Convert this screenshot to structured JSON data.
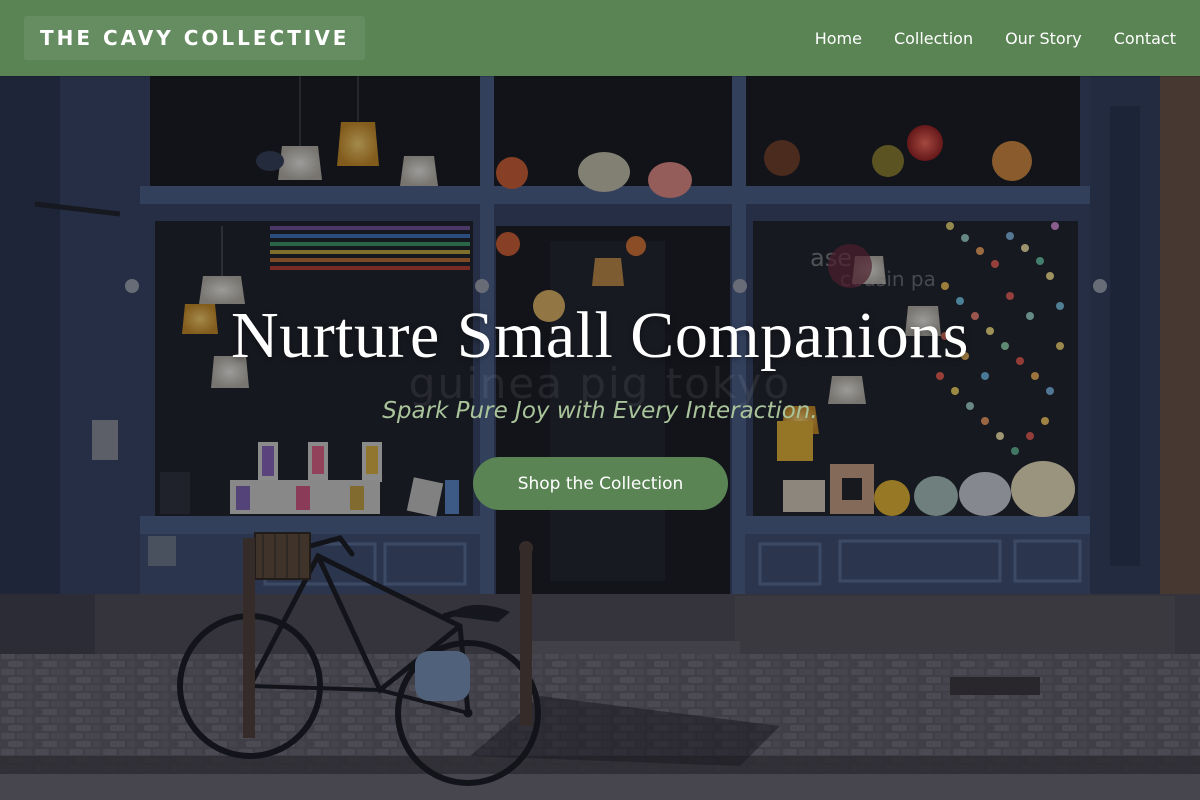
{
  "header": {
    "logo_text": "THE CAVY COLLECTIVE",
    "nav": [
      {
        "label": "Home"
      },
      {
        "label": "Collection"
      },
      {
        "label": "Our Story"
      },
      {
        "label": "Contact"
      }
    ]
  },
  "hero": {
    "title": "Nurture Small Companions",
    "subtitle": "Spark Pure Joy with Every Interaction.",
    "cta_label": "Shop the Collection",
    "storefront_window_text": "guinea pig tokyo",
    "window_sign_text": "ase\ncousin pa"
  },
  "colors": {
    "accent": "#5a8454",
    "subtitle": "#a9c39a",
    "storefront": "#3d4f73"
  }
}
